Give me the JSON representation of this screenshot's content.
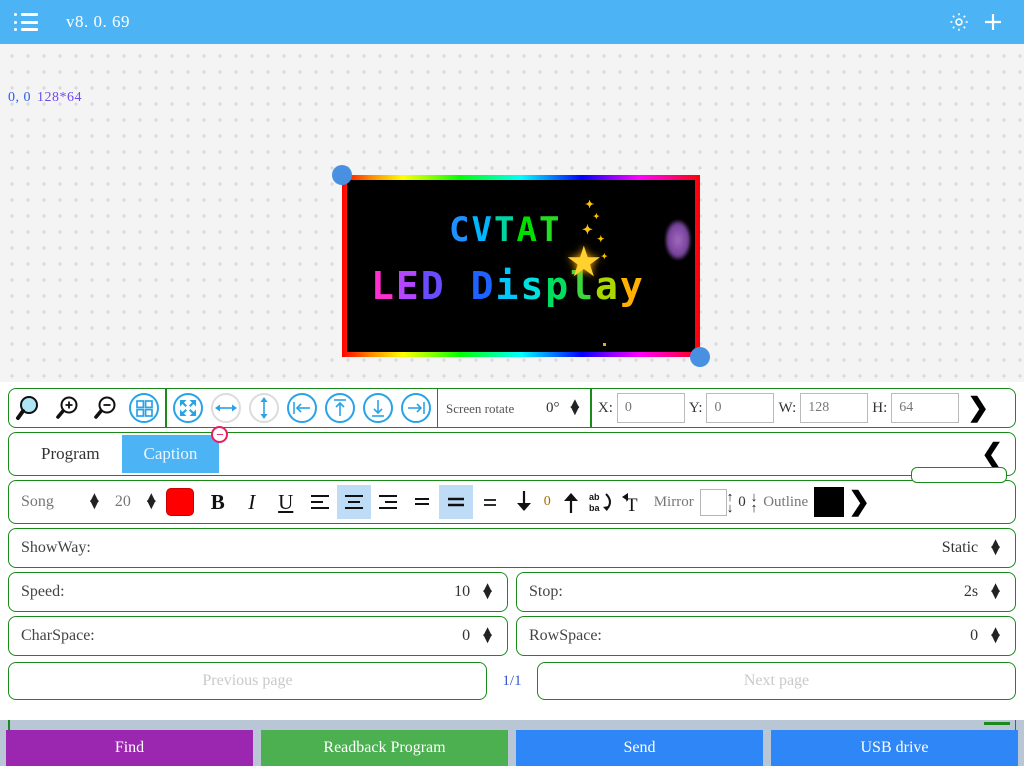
{
  "header": {
    "menu_icon": "hamburger-menu-icon",
    "version": "v8. 0. 69",
    "settings_icon": "gear-icon",
    "add_icon": "plus-icon"
  },
  "canvas": {
    "coord_origin": "0, 0",
    "dimensions": "128*64",
    "led_preview": {
      "line1": "CVTAT",
      "line2": "LED Display",
      "line1_colors": [
        "#1e90ff",
        "#00b7ff",
        "#00d4a0",
        "#00e000",
        "#22dd22"
      ],
      "line2_colors": [
        "#ff2fd0",
        "#b446ff",
        "#6a4bff",
        "#1e63ff",
        "#00c8ff",
        "#00e0e0",
        "#00e060",
        "#3ad83a",
        "#a8d800",
        "#ffb000",
        "#ff5500",
        "#ff0000"
      ],
      "background": "#000000",
      "border_style": "rainbow",
      "effect": "sparkle-star"
    },
    "handles": [
      "top-left",
      "bottom-right"
    ]
  },
  "toolbar": {
    "tools": [
      {
        "name": "zoom-fit-icon",
        "label": "Zoom"
      },
      {
        "name": "zoom-in-icon",
        "label": "Zoom In"
      },
      {
        "name": "zoom-out-icon",
        "label": "Zoom Out"
      },
      {
        "name": "grid-icon",
        "label": "Grid"
      },
      {
        "name": "fullscreen-icon",
        "label": "Fit Screen"
      },
      {
        "name": "stretch-horizontal-icon",
        "label": "Stretch Horizontal"
      },
      {
        "name": "stretch-vertical-icon",
        "label": "Stretch Vertical"
      },
      {
        "name": "align-left-icon",
        "label": "Align Left"
      },
      {
        "name": "align-top-icon",
        "label": "Align Top"
      },
      {
        "name": "align-bottom-icon",
        "label": "Align Bottom"
      },
      {
        "name": "align-right-icon",
        "label": "Align Right"
      }
    ],
    "screen_rotate_label": "Screen rotate",
    "screen_rotate_value": "0°",
    "x_label": "X:",
    "x_value": "0",
    "y_label": "Y:",
    "y_value": "0",
    "w_label": "W:",
    "w_value": "128",
    "h_label": "H:",
    "h_value": "64",
    "expand_icon": "chevron-right-icon"
  },
  "tabs": {
    "items": [
      {
        "label": "Program",
        "active": false
      },
      {
        "label": "Caption",
        "active": true
      }
    ],
    "close_badge": "⊖",
    "collapse_icon": "chevron-left-icon"
  },
  "format": {
    "font_name": "Song",
    "font_size": "20",
    "text_color": "#ff0000",
    "bold": "B",
    "italic": "I",
    "underline": "U",
    "align_left": "align-text-left-icon",
    "align_center": "align-text-center-icon",
    "align_right": "align-text-right-icon",
    "align_justify": "align-text-justify-icon",
    "valign_middle": "valign-middle-icon",
    "valign_bottom": "valign-bottom-icon",
    "move_down_icon": "arrow-down-icon",
    "spacing_value": "0",
    "move_up_icon": "arrow-up-icon",
    "reverse_icon": "abc-reverse-icon",
    "text_effect_icon": "text-wrap-icon",
    "mirror_label": "Mirror",
    "mirror_checked": false,
    "vertical_offset": "0",
    "outline_label": "Outline",
    "outline_color": "#000000",
    "expand_icon": "chevron-right-icon"
  },
  "settings": {
    "showway_label": "ShowWay:",
    "showway_value": "Static",
    "speed_label": "Speed:",
    "speed_value": "10",
    "stop_label": "Stop:",
    "stop_value": "2s",
    "charspace_label": "CharSpace:",
    "charspace_value": "0",
    "rowspace_label": "RowSpace:",
    "rowspace_value": "0"
  },
  "pager": {
    "previous_label": "Previous page",
    "indicator": "1/1",
    "next_label": "Next page"
  },
  "actions": {
    "find": "Find",
    "readback": "Readback Program",
    "send": "Send",
    "usb": "USB drive",
    "colors": {
      "find": "#9b27b0",
      "readback": "#4caf50",
      "send": "#2f86f6",
      "usb": "#2f86f6"
    }
  }
}
